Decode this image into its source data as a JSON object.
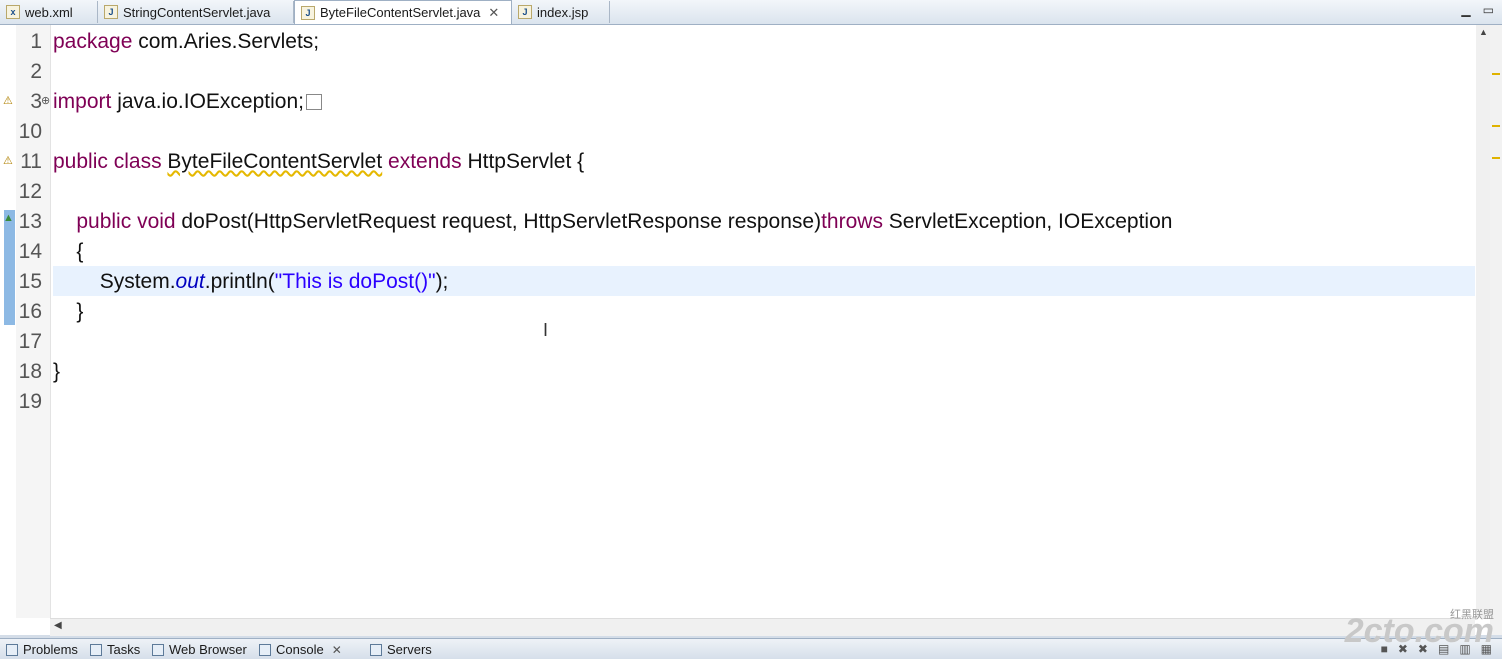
{
  "editor_tabs": [
    {
      "label": "web.xml",
      "icon": "xml-file-icon"
    },
    {
      "label": "StringContentServlet.java",
      "icon": "java-file-icon"
    },
    {
      "label": "ByteFileContentServlet.java",
      "icon": "java-file-icon",
      "active": true
    },
    {
      "label": "index.jsp",
      "icon": "jsp-file-icon"
    }
  ],
  "line_numbers": [
    "1",
    "2",
    "3",
    "10",
    "11",
    "12",
    "13",
    "14",
    "15",
    "16",
    "17",
    "18",
    "19"
  ],
  "code": {
    "l1_kw": "package",
    "l1_rest": " com.Aries.Servlets;",
    "l3_kw": "import",
    "l3_rest": " java.io.IOException;",
    "l11_kw1": "public",
    "l11_kw2": "class",
    "l11_name": "ByteFileContentServlet",
    "l11_kw3": "extends",
    "l11_rest": " HttpServlet {",
    "l13_kw1": "public",
    "l13_kw2": "void",
    "l13_mid": " doPost(HttpServletRequest request, HttpServletResponse response)",
    "l13_kw3": "throws",
    "l13_rest": " ServletException, IOException",
    "l14": "{",
    "l15_a": "System.",
    "l15_field": "out",
    "l15_b": ".println(",
    "l15_str": "\"This is doPost()\"",
    "l15_c": ");",
    "l16": "}",
    "l18": "}"
  },
  "bottom_tabs": [
    {
      "label": "Problems"
    },
    {
      "label": "Tasks"
    },
    {
      "label": "Web Browser"
    },
    {
      "label": "Console",
      "active": true
    },
    {
      "label": "Servers"
    }
  ],
  "watermark": {
    "main": "2cto.com",
    "sub": "红黑联盟"
  },
  "colors": {
    "keyword": "#7f0055",
    "string": "#2a00ff",
    "field": "#0000c0",
    "current_line": "#e8f2fe"
  }
}
